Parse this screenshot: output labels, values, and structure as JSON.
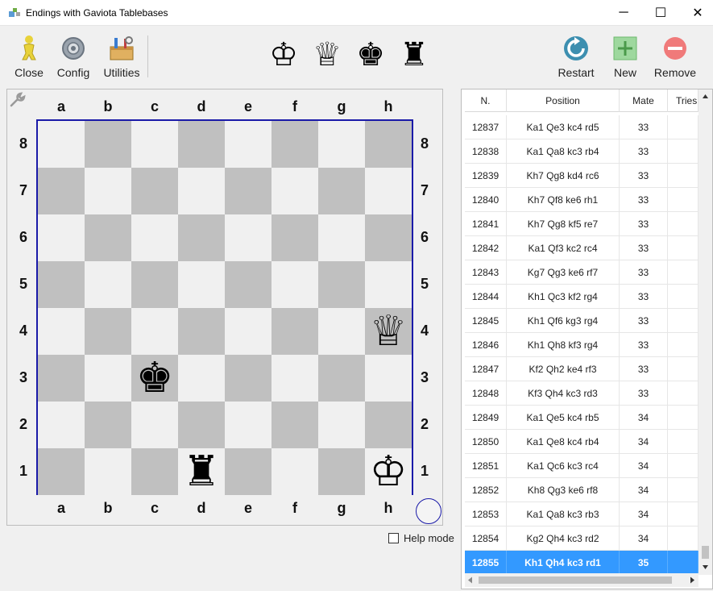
{
  "window": {
    "title": "Endings with Gaviota Tablebases",
    "minimize": "─",
    "maximize": "☐",
    "close": "✕"
  },
  "toolbar": {
    "close_label": "Close",
    "config_label": "Config",
    "utilities_label": "Utilities",
    "restart_label": "Restart",
    "new_label": "New",
    "remove_label": "Remove",
    "piece_tools": [
      "♔",
      "♕",
      "♚",
      "♜"
    ]
  },
  "board": {
    "files": [
      "a",
      "b",
      "c",
      "d",
      "e",
      "f",
      "g",
      "h"
    ],
    "ranks": [
      "8",
      "7",
      "6",
      "5",
      "4",
      "3",
      "2",
      "1"
    ],
    "pieces": [
      {
        "square": "h4",
        "glyph": "♕"
      },
      {
        "square": "c3",
        "glyph": "♚"
      },
      {
        "square": "d1",
        "glyph": "♜"
      },
      {
        "square": "h1",
        "glyph": "♔"
      }
    ],
    "light_color": "#f0f0f0",
    "dark_color": "#c0c0c0",
    "border_color": "#1a1aa8"
  },
  "help_mode_label": "Help mode",
  "table": {
    "headers": [
      "N.",
      "Position",
      "Mate",
      "Tries"
    ],
    "rows": [
      [
        "12837",
        "Ka1 Qe3 kc4 rd5",
        "33",
        ""
      ],
      [
        "12838",
        "Ka1 Qa8 kc3 rb4",
        "33",
        ""
      ],
      [
        "12839",
        "Kh7 Qg8 kd4 rc6",
        "33",
        ""
      ],
      [
        "12840",
        "Kh7 Qf8 ke6 rh1",
        "33",
        ""
      ],
      [
        "12841",
        "Kh7 Qg8 kf5 re7",
        "33",
        ""
      ],
      [
        "12842",
        "Ka1 Qf3 kc2 rc4",
        "33",
        ""
      ],
      [
        "12843",
        "Kg7 Qg3 ke6 rf7",
        "33",
        ""
      ],
      [
        "12844",
        "Kh1 Qc3 kf2 rg4",
        "33",
        ""
      ],
      [
        "12845",
        "Kh1 Qf6 kg3 rg4",
        "33",
        ""
      ],
      [
        "12846",
        "Kh1 Qh8 kf3 rg4",
        "33",
        ""
      ],
      [
        "12847",
        "Kf2 Qh2 ke4 rf3",
        "33",
        ""
      ],
      [
        "12848",
        "Kf3 Qh4 kc3 rd3",
        "33",
        ""
      ],
      [
        "12849",
        "Ka1 Qe5 kc4 rb5",
        "34",
        ""
      ],
      [
        "12850",
        "Ka1 Qe8 kc4 rb4",
        "34",
        ""
      ],
      [
        "12851",
        "Ka1 Qc6 kc3 rc4",
        "34",
        ""
      ],
      [
        "12852",
        "Kh8 Qg3 ke6 rf8",
        "34",
        ""
      ],
      [
        "12853",
        "Ka1 Qa8 kc3 rb3",
        "34",
        ""
      ],
      [
        "12854",
        "Kg2 Qh4 kc3 rd2",
        "34",
        ""
      ],
      [
        "12855",
        "Kh1 Qh4 kc3 rd1",
        "35",
        ""
      ]
    ],
    "selected_index": 18,
    "selected_color": "#3399ff"
  }
}
